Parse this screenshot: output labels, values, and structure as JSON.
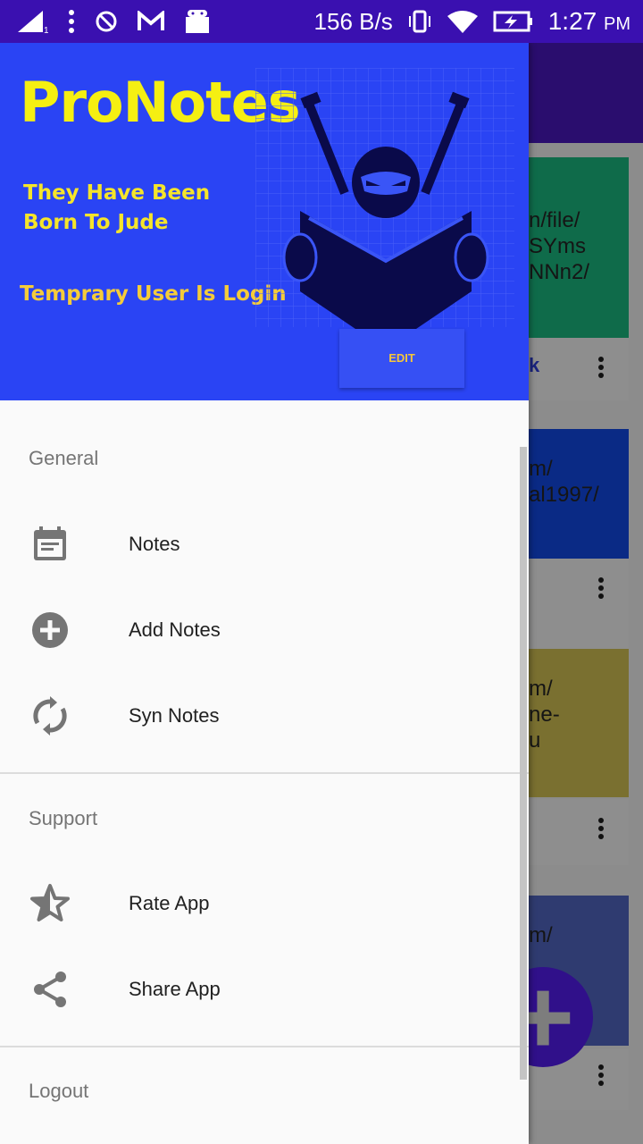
{
  "status_bar": {
    "network_speed": "156 B/s",
    "time": "1:27",
    "ampm": "PM"
  },
  "drawer": {
    "app_title": "ProNotes",
    "tagline": "They Have Been Born To Jude",
    "login_status": "Temprary User Is Login",
    "edit_label": "EDIT",
    "sections": [
      {
        "title": "General",
        "items": [
          {
            "label": "Notes",
            "icon": "calendar-note-icon"
          },
          {
            "label": "Add Notes",
            "icon": "add-circle-icon"
          },
          {
            "label": "Syn Notes",
            "icon": "sync-icon"
          }
        ]
      },
      {
        "title": "Support",
        "items": [
          {
            "label": "Rate App",
            "icon": "star-half-icon"
          },
          {
            "label": "Share App",
            "icon": "share-icon"
          }
        ]
      },
      {
        "title": "Logout",
        "items": []
      }
    ]
  },
  "background": {
    "cards": [
      {
        "lines": [
          "n/file/",
          "SYms",
          "NNn2/"
        ],
        "footer": "k",
        "color": "#0f6b4a"
      },
      {
        "lines": [
          "m/",
          "al1997/"
        ],
        "footer": "",
        "color": "#0a2a85"
      },
      {
        "lines": [
          "m/",
          "",
          "ne-",
          "u"
        ],
        "footer": "",
        "color": "#7a7030"
      },
      {
        "lines": [
          "m/"
        ],
        "footer": "",
        "color": "#2f3b70"
      }
    ]
  },
  "colors": {
    "status_bar": "#3a10b0",
    "header": "#2a44f4",
    "title": "#f5ef12"
  }
}
